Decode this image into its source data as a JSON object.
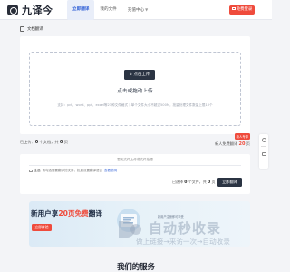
{
  "brand": {
    "name": "九译今"
  },
  "nav": {
    "items": [
      {
        "label": "立即翻译",
        "active": true
      },
      {
        "label": "我的文件",
        "active": false
      },
      {
        "label": "充值中心",
        "active": false,
        "caret": true
      }
    ]
  },
  "header": {
    "login_label": "免费登录"
  },
  "breadcrumb": {
    "label": "文档翻译"
  },
  "upload": {
    "button_label": "点击上传",
    "hint": "点击或拖动上传",
    "support_text": "支持：pdf、word、ppt、excel等23种文件格式｜单个文件大小不超过500M，批量处理文件数量上限10个"
  },
  "summary": {
    "uploaded_label": "已上传：",
    "files_value": "0",
    "files_unit": "个文档，共",
    "pages_value": "0",
    "pages_unit": "页",
    "badge": "新人专享",
    "free_label": "新人免费翻译",
    "free_value": "20",
    "free_unit": "页"
  },
  "file_panel": {
    "title": "暂无文件上传或文件处理",
    "tag": "全选",
    "row_note": "请勾选需要翻译的文件，批量设置翻译语言",
    "row_link": "查看说明",
    "pair_label": "已选择",
    "pair_files": "0",
    "pair_files_unit": "个文件，共",
    "pair_pages": "0",
    "pair_pages_unit": "页",
    "translate_label": "立即翻译"
  },
  "banner": {
    "title_pre": "新用户享",
    "title_highlight": "20页免费",
    "title_post": "翻译",
    "button_label": "立即体验",
    "caption": "新用户注册即可享受"
  },
  "watermark": {
    "big": "自动秒收录",
    "small": "做上链接→来访一次→自动收录"
  },
  "services": {
    "title": "我们的服务"
  },
  "colors": {
    "accent": "#ef4b3c",
    "dark": "#2b3443",
    "nav_active": "#2f5fd6"
  }
}
